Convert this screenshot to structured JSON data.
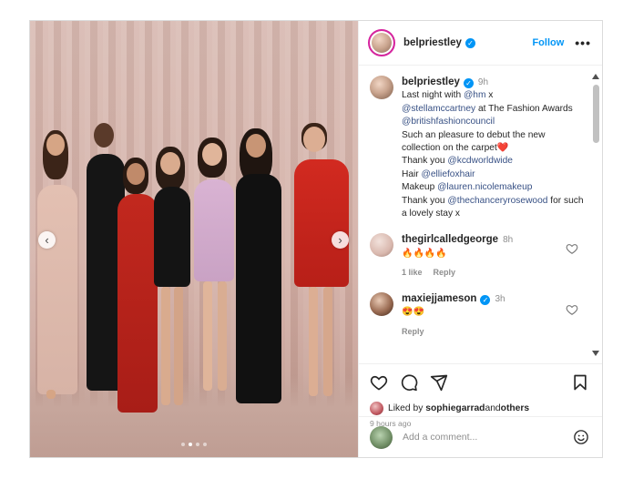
{
  "post": {
    "username": "belpriestley",
    "follow_label": "Follow",
    "more_label": "•••",
    "carousel": {
      "slides": 4,
      "active_slide": 2
    }
  },
  "caption": {
    "username": "belpriestley",
    "time": "9h",
    "line1_pre": "Last night with ",
    "mention_hm": "@hm",
    "line1_post": " x",
    "mention_stella": "@stellamccartney",
    "line2_post": " at The Fashion Awards ",
    "mention_bfc": "@britishfashioncouncil",
    "line3": "Such an pleasure to debut the new collection on the carpet",
    "heart": "❤️",
    "thanks1_pre": "Thank you ",
    "mention_kcd": "@kcdworldwide",
    "hair_pre": "Hair ",
    "mention_hair": "@elliefoxhair",
    "makeup_pre": "Makeup ",
    "mention_makeup": "@lauren.nicolemakeup",
    "thanks2_pre": "Thank you ",
    "mention_chancery": "@thechanceryrosewood",
    "thanks2_post": " for such a lovely stay x"
  },
  "comments": [
    {
      "username": "thegirlcalledgeorge",
      "time": "8h",
      "text": "🔥🔥🔥🔥",
      "likes": "1 like",
      "reply": "Reply"
    },
    {
      "username": "maxiejjameson",
      "time": "3h",
      "text": "😍😍",
      "reply": "Reply"
    }
  ],
  "likes": {
    "pre": "Liked by ",
    "user": "sophiegarrad",
    "mid": " and ",
    "others": "others",
    "ago": "9 hours ago"
  },
  "add_comment": {
    "placeholder": "Add a comment..."
  },
  "colors": {
    "accent": "#0095f6",
    "link": "#385185",
    "heart": "#ed4956",
    "muted": "#8e8e8e"
  },
  "icons": [
    "heart-icon",
    "comment-icon",
    "share-icon",
    "bookmark-icon",
    "smile-icon",
    "verified-icon"
  ]
}
